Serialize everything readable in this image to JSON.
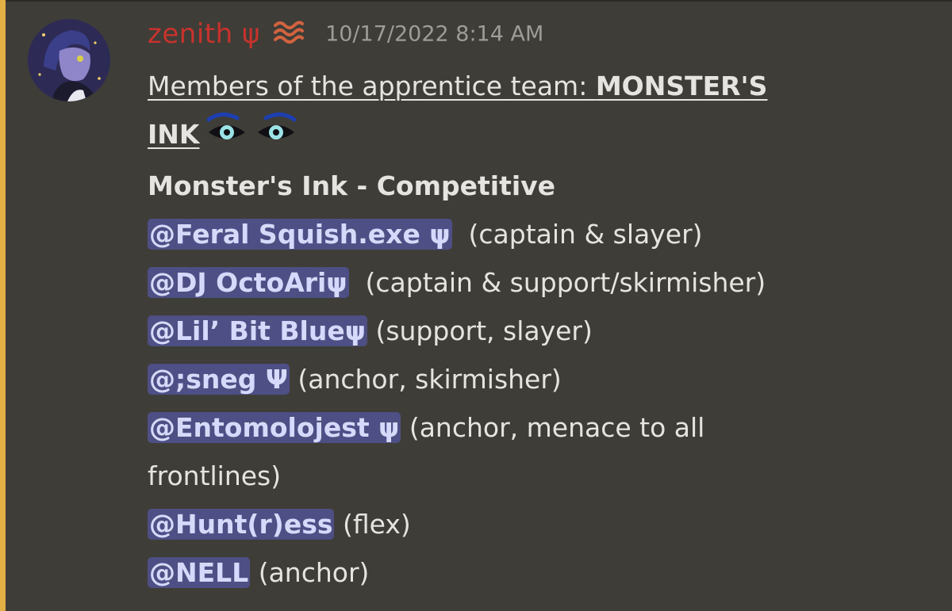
{
  "message": {
    "author": {
      "username": "zenith ψ",
      "role_icon": "wave-icon",
      "avatar": "avatar-image"
    },
    "timestamp": "10/17/2022 8:14 AM",
    "intro_text": "Members of the apprentice team: ",
    "team_name_part1": "MONSTER'S",
    "team_name_part2": "INK",
    "eyes_icon": "eyes-emoji",
    "section_title": "Monster's Ink - Competitive",
    "members": [
      {
        "mention": "@Feral Squish.exe ψ",
        "role": "  (captain & slayer)"
      },
      {
        "mention": "@DJ OctoAriψ",
        "role": "  (captain & support/skirmisher)"
      },
      {
        "mention": "@Lil’ Bit Blueψ",
        "role": " (support, slayer)"
      },
      {
        "mention": "@;sneg Ψ",
        "role": " (anchor, skirmisher)"
      },
      {
        "mention": "@Entomolojest ψ",
        "role": " (anchor, menace to all",
        "role_cont": "frontlines)"
      },
      {
        "mention": "@Hunt(r)ess",
        "role": " (flex)"
      },
      {
        "mention": "@NELL",
        "role": " (anchor)"
      }
    ],
    "colors": {
      "background": "#3f3d38",
      "accent_bar": "#e2b044",
      "username": "#c8322c",
      "mention_bg": "#4e4f84",
      "mention_text": "#d6d9ff"
    }
  }
}
